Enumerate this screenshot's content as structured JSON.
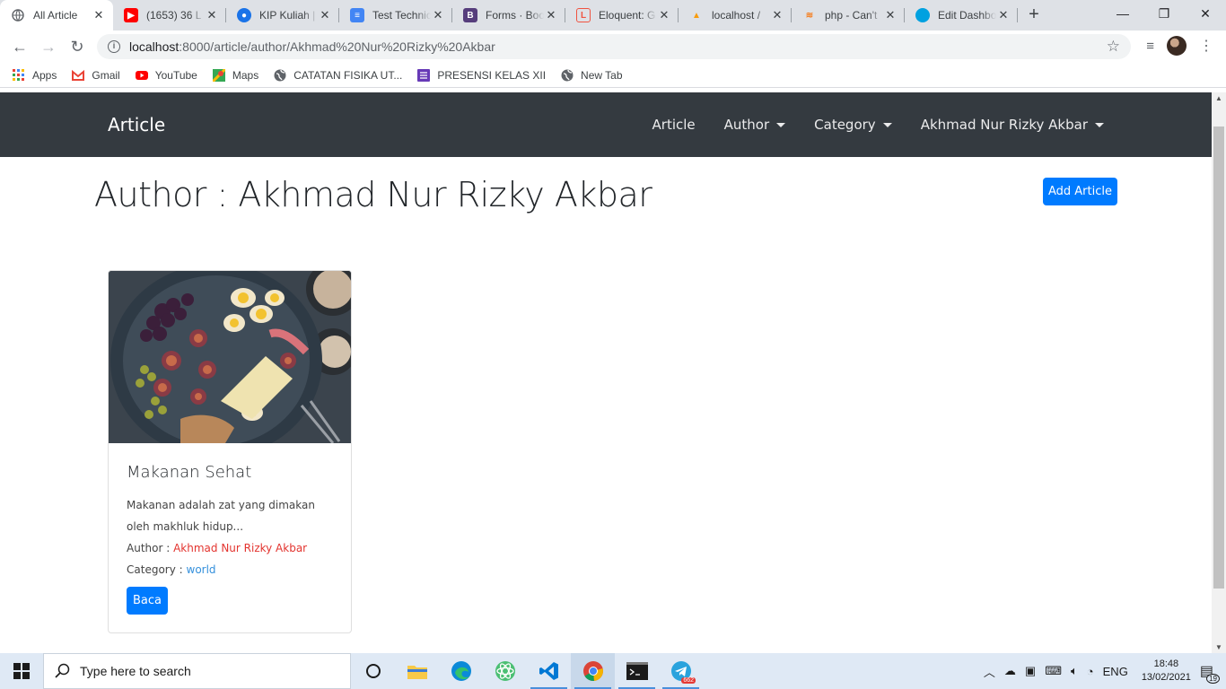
{
  "browser": {
    "tabs": [
      {
        "title": "All Article",
        "icon": "globe-icon",
        "color": "#5f6368",
        "active": true
      },
      {
        "title": "(1653) 36 L",
        "icon": "youtube-icon",
        "color": "#ff0000"
      },
      {
        "title": "KIP Kuliah |",
        "icon": "kip-icon",
        "color": "#1a73e8"
      },
      {
        "title": "Test Technic",
        "icon": "docs-icon",
        "color": "#4285f4"
      },
      {
        "title": "Forms · Boo",
        "icon": "bootstrap-icon",
        "color": "#563d7c"
      },
      {
        "title": "Eloquent: G",
        "icon": "laravel-icon",
        "color": "#f05340"
      },
      {
        "title": "localhost / ",
        "icon": "phpmyadmin-icon",
        "color": "#f89c0e"
      },
      {
        "title": "php - Can't",
        "icon": "stackoverflow-icon",
        "color": "#f48024"
      },
      {
        "title": "Edit Dashbo",
        "icon": "salesforce-icon",
        "color": "#00a1e0"
      }
    ],
    "url_host": "localhost",
    "url_path": ":8000/article/author/Akhmad%20Nur%20Rizky%20Akbar",
    "bookmarks": [
      {
        "label": "Apps",
        "icon": "apps-grid-icon"
      },
      {
        "label": "Gmail",
        "icon": "gmail-icon"
      },
      {
        "label": "YouTube",
        "icon": "youtube-icon"
      },
      {
        "label": "Maps",
        "icon": "maps-icon"
      },
      {
        "label": "CATATAN FISIKA UT...",
        "icon": "globe-icon"
      },
      {
        "label": "PRESENSI KELAS XII",
        "icon": "forms-icon"
      },
      {
        "label": "New Tab",
        "icon": "globe-icon"
      }
    ]
  },
  "site": {
    "brand": "Article",
    "nav": {
      "article": "Article",
      "author": "Author",
      "category": "Category",
      "user": "Akhmad Nur Rizky Akbar"
    },
    "heading": "Author : Akhmad Nur Rizky Akbar",
    "add_button": "Add Article",
    "card": {
      "title": "Makanan Sehat",
      "excerpt": "Makanan adalah zat yang dimakan oleh makhluk hidup...",
      "author_label": "Author : ",
      "author": "Akhmad Nur Rizky Akbar",
      "category_label": "Category : ",
      "category": "world",
      "read_button": "Baca"
    }
  },
  "taskbar": {
    "search_placeholder": "Type here to search",
    "lang": "ENG",
    "time": "18:48",
    "date": "13/02/2021",
    "notifications": "19",
    "telegram_badge": "662"
  },
  "colors": {
    "navbar": "#343a40",
    "primary": "#007bff",
    "author_link": "#e3342f",
    "category_link": "#3490dc"
  }
}
